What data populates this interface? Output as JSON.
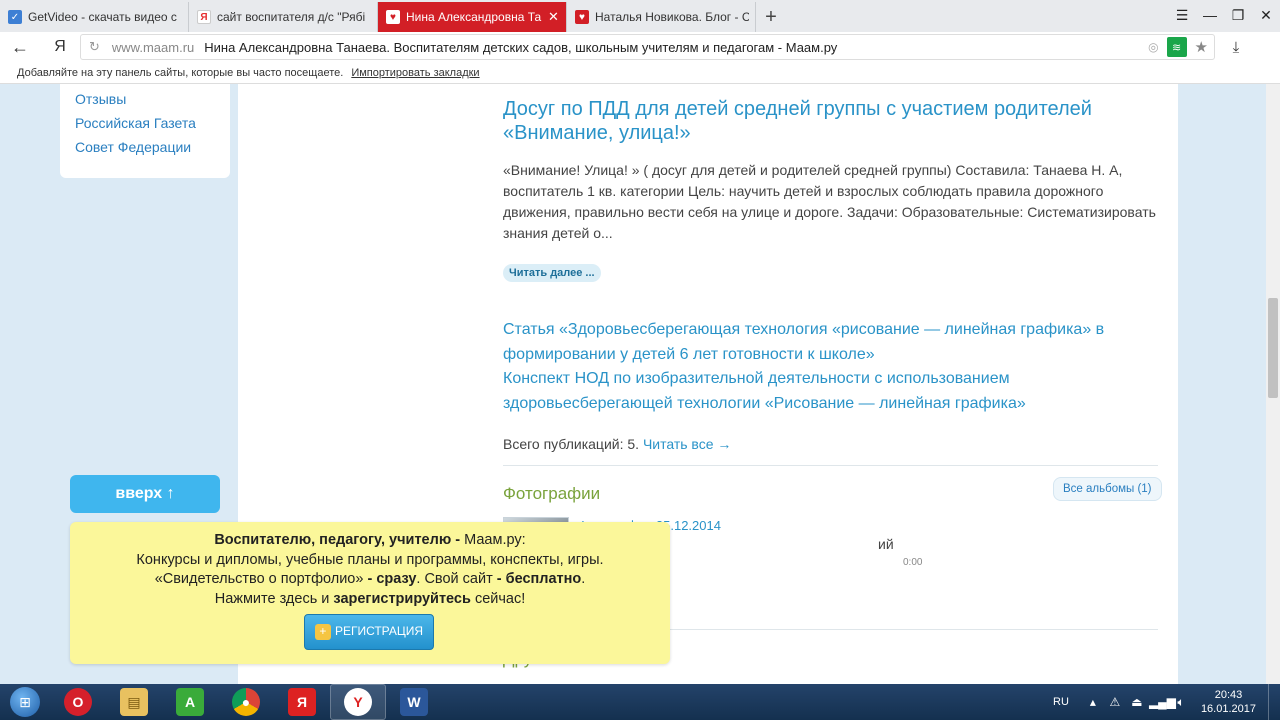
{
  "browser": {
    "tabs": [
      {
        "title": "GetVideo - скачать видео с",
        "favicon": "getvideo-icon",
        "active": false
      },
      {
        "title": "сайт воспитателя д/с \"Рябі",
        "favicon": "yandex-icon",
        "active": false
      },
      {
        "title": "Нина Александровна Та",
        "favicon": "heart-icon",
        "active": true
      },
      {
        "title": "Наталья Новикова. Блог - С",
        "favicon": "heart-icon",
        "active": false
      }
    ],
    "new_tab": "+",
    "url_host": "www.maam.ru",
    "url_title": "Нина Александровна Танаева. Воспитателям детских садов, школьным учителям и педагогам - Маам.ру",
    "bookmarks_hint": "Добавляйте на эту панель сайты, которые вы часто посещаете.",
    "bookmarks_import": "Импортировать закладки"
  },
  "sidebar": {
    "links": [
      "Отзывы",
      "Российская Газета",
      "Совет Федерации"
    ],
    "up_button": "вверх ↑"
  },
  "article": {
    "title": "Досуг по ПДД для детей средней группы с участием родителей «Внимание, улица!»",
    "excerpt": "«Внимание! Улица! » ( досуг для детей и родителей средней группы) Составила: Танаева Н. А, воспитатель 1 кв. категории Цель: научить детей и взрослых соблюдать правила дорожного движения, правильно вести себя на улице и дороге. Задачи: Образовательные: Систематизировать знания детей о...",
    "read_more": "Читать далее ..."
  },
  "publications": {
    "links": [
      "Статья «Здоровьесберегающая технология «рисование — линейная графика»  в формировании у детей 6 лет готовности к школе»",
      "Конспект НОД по изобразительной деятельности с использованием здоровьесберегающей технологии «Рисование — линейная графика»"
    ],
    "count_text": "Всего публикаций: 5.",
    "read_all": "Читать все →"
  },
  "photos": {
    "title": "Фотографии",
    "albums_button": "Все альбомы (1)",
    "date": "Фотографии 25.12.2014",
    "desc": "ий",
    "time": "0:00"
  },
  "friends": {
    "title": "Друзья"
  },
  "promo": {
    "line1_bold": "Воспитателю, педагогу, учителю -",
    "line1_rest": " Маам.ру:",
    "line2": "Конкурсы и дипломы, учебные планы и программы, конспекты, игры.",
    "line3_a": "«Свидетельство о портфолио»",
    "line3_b": " - сразу",
    "line3_c": ". Свой сайт ",
    "line3_d": "- бесплатно",
    "line3_e": ".",
    "line4_a": "Нажмите здесь и ",
    "line4_b": "зарегистрируйтесь",
    "line4_c": " сейчас!",
    "register_button": "РЕГИСТРАЦИЯ"
  },
  "taskbar": {
    "apps": [
      "opera-icon",
      "file-explorer-icon",
      "app-a-icon",
      "chrome-icon",
      "yandex-icon",
      "yandex-browser-icon",
      "word-icon"
    ],
    "lang": "RU",
    "time": "20:43",
    "date": "16.01.2017"
  },
  "colors": {
    "active_tab": "#d21f26",
    "link_blue": "#2a93c8",
    "section_green": "#7aa33c",
    "promo_yellow": "#fbf79a",
    "up_button": "#3fb6ee"
  }
}
